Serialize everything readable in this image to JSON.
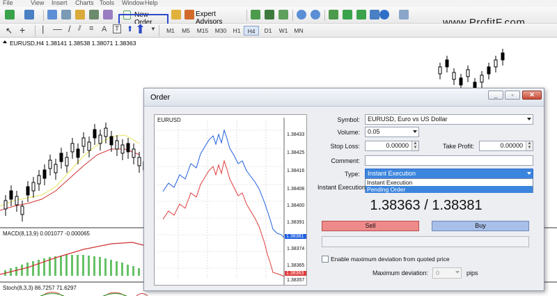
{
  "menubar": {
    "items": [
      "File",
      "View",
      "Insert",
      "Charts",
      "Tools",
      "Window",
      "Help"
    ]
  },
  "toolbar": {
    "new_order_label": "New Order",
    "expert_advisors_label": "Expert Advisors",
    "timeframes": [
      "M1",
      "M5",
      "M15",
      "M30",
      "H1",
      "H4",
      "D1",
      "W1",
      "MN"
    ],
    "active_timeframe": "H4"
  },
  "watermark": "www.ProfitF.com",
  "chart": {
    "symbol_info": "EURUSD,H4  1.38141 1.38538 1.38071 1.38363",
    "macd_info": "MACD(8,13,9) 0.001077 -0.000065",
    "stoch_info": "Stoch(8,3,3) 86.7257 71.6297"
  },
  "dialog": {
    "title": "Order",
    "mini_chart": {
      "symbol": "EURUSD",
      "price_ticks": [
        "1.38433",
        "1.38425",
        "1.38416",
        "1.38408",
        "1.38400",
        "1.38391",
        "1.38381",
        "1.38374",
        "1.38365",
        "1.38363",
        "1.38357"
      ],
      "ask_tag": "1.38381",
      "bid_tag": "1.38363"
    },
    "symbol_label": "Symbol:",
    "symbol_value": "EURUSD, Euro vs US Dollar",
    "volume_label": "Volume:",
    "volume_value": "0.05",
    "stop_loss_label": "Stop Loss:",
    "stop_loss_value": "0.00000",
    "take_profit_label": "Take Profit:",
    "take_profit_value": "0.00000",
    "comment_label": "Comment:",
    "comment_value": "",
    "type_label": "Type:",
    "type_value": "Instant Execution",
    "type_options": [
      "Instant Execution",
      "Pending Order"
    ],
    "instant_execution_heading": "Instant Execution",
    "quote": "1.38363 / 1.38381",
    "sell_label": "Sell",
    "buy_label": "Buy",
    "max_dev_checkbox_label": "Enable maximum deviation from quoted price",
    "max_dev_label": "Maximum deviation:",
    "max_dev_value": "0",
    "max_dev_unit": "pips"
  },
  "colors": {
    "sell": "#ee8a8a",
    "buy": "#a8bfe8",
    "ask_line": "#1f5fe0",
    "bid_line": "#e03a3a",
    "highlight": "#2c49c9",
    "selection": "#3c85dd"
  }
}
